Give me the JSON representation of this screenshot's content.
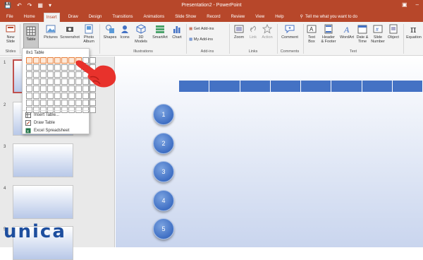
{
  "window": {
    "title": "Presentation2 - PowerPoint"
  },
  "tabs": [
    "File",
    "Home",
    "Insert",
    "Draw",
    "Design",
    "Transitions",
    "Animations",
    "Slide Show",
    "Record",
    "Review",
    "View",
    "Help"
  ],
  "active_tab": "Insert",
  "tellme": "Tell me what you want to do",
  "ribbon": {
    "new_slide": "New\nSlide",
    "table": "Table",
    "pictures": "Pictures",
    "screenshot": "Screenshot",
    "photo_album": "Photo\nAlbum",
    "shapes": "Shapes",
    "icons": "Icons",
    "models_3d": "3D\nModels",
    "smartart": "SmartArt",
    "chart": "Chart",
    "get_addins": "Get Add-ins",
    "my_addins": "My Add-ins",
    "zoom": "Zoom",
    "link": "Link",
    "action": "Action",
    "comment": "Comment",
    "text_box": "Text\nBox",
    "header_footer": "Header\n& Footer",
    "wordart": "WordArt",
    "date_time": "Date &\nTime",
    "slide_number": "Slide\nNumber",
    "object": "Object",
    "equation": "Equation",
    "groups": {
      "slides": "Slides",
      "illustrations": "Illustrations",
      "addins": "Add-ins",
      "links": "Links",
      "comments": "Comments",
      "text": "Text"
    }
  },
  "table_dropdown": {
    "label": "8x1 Table",
    "rows": 8,
    "cols": 10,
    "selected_cols": 8,
    "selected_rows": 1,
    "insert_table": "Insert Table...",
    "draw_table": "Draw Table",
    "excel_spreadsheet": "Excel Spreadsheet"
  },
  "thumbnails": [
    "1",
    "2",
    "3",
    "4",
    "5"
  ],
  "slide": {
    "circles": [
      "1",
      "2",
      "3",
      "4",
      "5"
    ],
    "accent": "#4472c4"
  },
  "logo": "unica",
  "colors": {
    "brand": "#b7472a",
    "ribbon_bg": "#f3f3f3",
    "table_fill": "#4472c4"
  }
}
